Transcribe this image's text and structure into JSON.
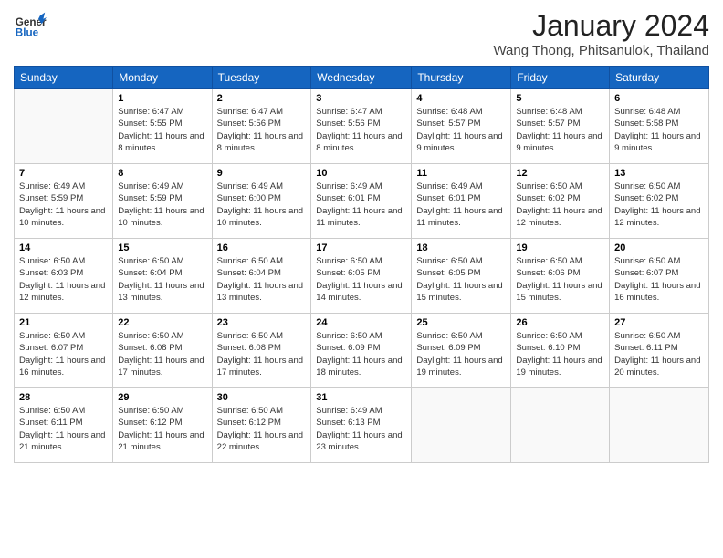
{
  "header": {
    "logo_general": "General",
    "logo_blue": "Blue",
    "month_title": "January 2024",
    "location": "Wang Thong, Phitsanulok, Thailand"
  },
  "weekdays": [
    "Sunday",
    "Monday",
    "Tuesday",
    "Wednesday",
    "Thursday",
    "Friday",
    "Saturday"
  ],
  "weeks": [
    [
      {
        "day": "",
        "sunrise": "",
        "sunset": "",
        "daylight": ""
      },
      {
        "day": "1",
        "sunrise": "Sunrise: 6:47 AM",
        "sunset": "Sunset: 5:55 PM",
        "daylight": "Daylight: 11 hours and 8 minutes."
      },
      {
        "day": "2",
        "sunrise": "Sunrise: 6:47 AM",
        "sunset": "Sunset: 5:56 PM",
        "daylight": "Daylight: 11 hours and 8 minutes."
      },
      {
        "day": "3",
        "sunrise": "Sunrise: 6:47 AM",
        "sunset": "Sunset: 5:56 PM",
        "daylight": "Daylight: 11 hours and 8 minutes."
      },
      {
        "day": "4",
        "sunrise": "Sunrise: 6:48 AM",
        "sunset": "Sunset: 5:57 PM",
        "daylight": "Daylight: 11 hours and 9 minutes."
      },
      {
        "day": "5",
        "sunrise": "Sunrise: 6:48 AM",
        "sunset": "Sunset: 5:57 PM",
        "daylight": "Daylight: 11 hours and 9 minutes."
      },
      {
        "day": "6",
        "sunrise": "Sunrise: 6:48 AM",
        "sunset": "Sunset: 5:58 PM",
        "daylight": "Daylight: 11 hours and 9 minutes."
      }
    ],
    [
      {
        "day": "7",
        "sunrise": "Sunrise: 6:49 AM",
        "sunset": "Sunset: 5:59 PM",
        "daylight": "Daylight: 11 hours and 10 minutes."
      },
      {
        "day": "8",
        "sunrise": "Sunrise: 6:49 AM",
        "sunset": "Sunset: 5:59 PM",
        "daylight": "Daylight: 11 hours and 10 minutes."
      },
      {
        "day": "9",
        "sunrise": "Sunrise: 6:49 AM",
        "sunset": "Sunset: 6:00 PM",
        "daylight": "Daylight: 11 hours and 10 minutes."
      },
      {
        "day": "10",
        "sunrise": "Sunrise: 6:49 AM",
        "sunset": "Sunset: 6:01 PM",
        "daylight": "Daylight: 11 hours and 11 minutes."
      },
      {
        "day": "11",
        "sunrise": "Sunrise: 6:49 AM",
        "sunset": "Sunset: 6:01 PM",
        "daylight": "Daylight: 11 hours and 11 minutes."
      },
      {
        "day": "12",
        "sunrise": "Sunrise: 6:50 AM",
        "sunset": "Sunset: 6:02 PM",
        "daylight": "Daylight: 11 hours and 12 minutes."
      },
      {
        "day": "13",
        "sunrise": "Sunrise: 6:50 AM",
        "sunset": "Sunset: 6:02 PM",
        "daylight": "Daylight: 11 hours and 12 minutes."
      }
    ],
    [
      {
        "day": "14",
        "sunrise": "Sunrise: 6:50 AM",
        "sunset": "Sunset: 6:03 PM",
        "daylight": "Daylight: 11 hours and 12 minutes."
      },
      {
        "day": "15",
        "sunrise": "Sunrise: 6:50 AM",
        "sunset": "Sunset: 6:04 PM",
        "daylight": "Daylight: 11 hours and 13 minutes."
      },
      {
        "day": "16",
        "sunrise": "Sunrise: 6:50 AM",
        "sunset": "Sunset: 6:04 PM",
        "daylight": "Daylight: 11 hours and 13 minutes."
      },
      {
        "day": "17",
        "sunrise": "Sunrise: 6:50 AM",
        "sunset": "Sunset: 6:05 PM",
        "daylight": "Daylight: 11 hours and 14 minutes."
      },
      {
        "day": "18",
        "sunrise": "Sunrise: 6:50 AM",
        "sunset": "Sunset: 6:05 PM",
        "daylight": "Daylight: 11 hours and 15 minutes."
      },
      {
        "day": "19",
        "sunrise": "Sunrise: 6:50 AM",
        "sunset": "Sunset: 6:06 PM",
        "daylight": "Daylight: 11 hours and 15 minutes."
      },
      {
        "day": "20",
        "sunrise": "Sunrise: 6:50 AM",
        "sunset": "Sunset: 6:07 PM",
        "daylight": "Daylight: 11 hours and 16 minutes."
      }
    ],
    [
      {
        "day": "21",
        "sunrise": "Sunrise: 6:50 AM",
        "sunset": "Sunset: 6:07 PM",
        "daylight": "Daylight: 11 hours and 16 minutes."
      },
      {
        "day": "22",
        "sunrise": "Sunrise: 6:50 AM",
        "sunset": "Sunset: 6:08 PM",
        "daylight": "Daylight: 11 hours and 17 minutes."
      },
      {
        "day": "23",
        "sunrise": "Sunrise: 6:50 AM",
        "sunset": "Sunset: 6:08 PM",
        "daylight": "Daylight: 11 hours and 17 minutes."
      },
      {
        "day": "24",
        "sunrise": "Sunrise: 6:50 AM",
        "sunset": "Sunset: 6:09 PM",
        "daylight": "Daylight: 11 hours and 18 minutes."
      },
      {
        "day": "25",
        "sunrise": "Sunrise: 6:50 AM",
        "sunset": "Sunset: 6:09 PM",
        "daylight": "Daylight: 11 hours and 19 minutes."
      },
      {
        "day": "26",
        "sunrise": "Sunrise: 6:50 AM",
        "sunset": "Sunset: 6:10 PM",
        "daylight": "Daylight: 11 hours and 19 minutes."
      },
      {
        "day": "27",
        "sunrise": "Sunrise: 6:50 AM",
        "sunset": "Sunset: 6:11 PM",
        "daylight": "Daylight: 11 hours and 20 minutes."
      }
    ],
    [
      {
        "day": "28",
        "sunrise": "Sunrise: 6:50 AM",
        "sunset": "Sunset: 6:11 PM",
        "daylight": "Daylight: 11 hours and 21 minutes."
      },
      {
        "day": "29",
        "sunrise": "Sunrise: 6:50 AM",
        "sunset": "Sunset: 6:12 PM",
        "daylight": "Daylight: 11 hours and 21 minutes."
      },
      {
        "day": "30",
        "sunrise": "Sunrise: 6:50 AM",
        "sunset": "Sunset: 6:12 PM",
        "daylight": "Daylight: 11 hours and 22 minutes."
      },
      {
        "day": "31",
        "sunrise": "Sunrise: 6:49 AM",
        "sunset": "Sunset: 6:13 PM",
        "daylight": "Daylight: 11 hours and 23 minutes."
      },
      {
        "day": "",
        "sunrise": "",
        "sunset": "",
        "daylight": ""
      },
      {
        "day": "",
        "sunrise": "",
        "sunset": "",
        "daylight": ""
      },
      {
        "day": "",
        "sunrise": "",
        "sunset": "",
        "daylight": ""
      }
    ]
  ]
}
